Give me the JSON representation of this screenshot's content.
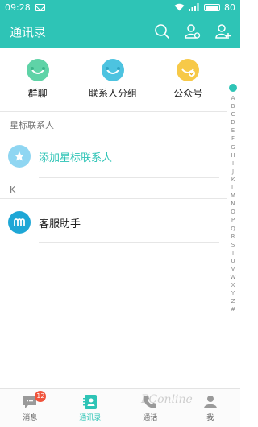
{
  "status_bar": {
    "time": "09:28",
    "battery": "80"
  },
  "header": {
    "title": "通讯录"
  },
  "quick_entries": [
    {
      "label": "群聊",
      "color": "#5fd3a7"
    },
    {
      "label": "联系人分组",
      "color": "#4dc3e0"
    },
    {
      "label": "公众号",
      "color": "#f7c948"
    }
  ],
  "sections": {
    "starred_header": "星标联系人",
    "add_starred": "添加星标联系人",
    "k_header": "K",
    "kefu_name": "客服助手"
  },
  "alphabet": [
    "A",
    "B",
    "C",
    "D",
    "E",
    "F",
    "G",
    "H",
    "I",
    "J",
    "K",
    "L",
    "M",
    "N",
    "O",
    "P",
    "Q",
    "R",
    "S",
    "T",
    "U",
    "V",
    "W",
    "X",
    "Y",
    "Z",
    "#"
  ],
  "bottom_nav": [
    {
      "label": "消息",
      "badge": "12"
    },
    {
      "label": "通讯录"
    },
    {
      "label": "通话"
    },
    {
      "label": "我"
    }
  ],
  "watermark": "PConline",
  "colors": {
    "accent": "#2ec4b6",
    "kefu_avatar": "#1ea7d6",
    "starred_avatar": "#8fd6f2"
  }
}
